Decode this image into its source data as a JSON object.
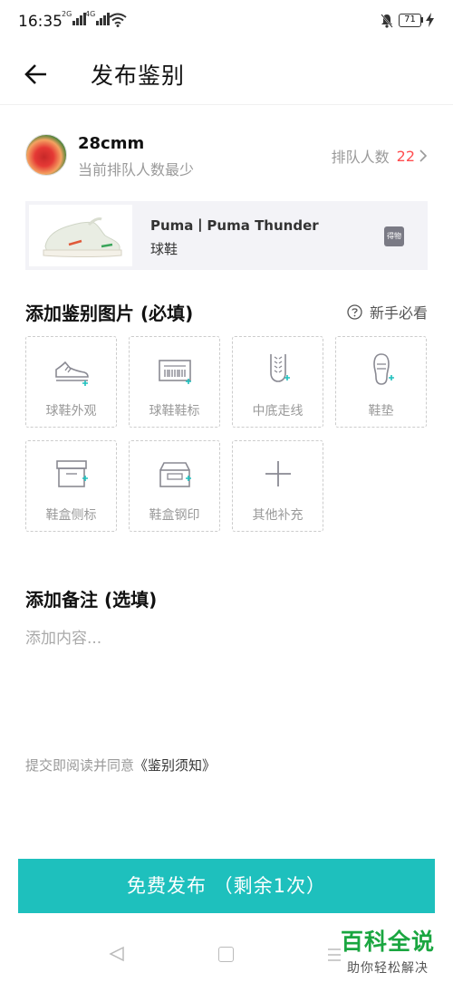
{
  "status_bar": {
    "time": "16:35",
    "signal_1": "2G",
    "signal_2": "4G",
    "battery": "71"
  },
  "nav": {
    "title": "发布鉴别"
  },
  "user": {
    "name": "28cmm",
    "subtitle": "当前排队人数最少",
    "queue_label": "排队人数",
    "queue_count": "22"
  },
  "product": {
    "name": "Puma丨Puma Thunder",
    "category": "球鞋",
    "badge": "得物"
  },
  "images_section": {
    "title": "添加鉴别图片 (必填)",
    "guide_label": "新手必看",
    "tiles": [
      {
        "label": "球鞋外观",
        "icon": "sneaker-icon"
      },
      {
        "label": "球鞋鞋标",
        "icon": "barcode-label-icon"
      },
      {
        "label": "中底走线",
        "icon": "stitching-icon"
      },
      {
        "label": "鞋垫",
        "icon": "insole-icon"
      },
      {
        "label": "鞋盒侧标",
        "icon": "shoebox-side-icon"
      },
      {
        "label": "鞋盒钢印",
        "icon": "shoebox-stamp-icon"
      },
      {
        "label": "其他补充",
        "icon": "plus-icon"
      }
    ]
  },
  "notes_section": {
    "title": "添加备注 (选填)",
    "placeholder": "添加内容..."
  },
  "agreement": {
    "prefix": "提交即阅读并同意",
    "link": "《鉴别须知》"
  },
  "submit": {
    "label": "免费发布 （剩余1次）"
  },
  "watermark": {
    "main": "百科全说",
    "sub": "助你轻松解决"
  },
  "colors": {
    "accent": "#1ec0bd",
    "queue_count": "#ff4d4f",
    "plus_marker": "#1ec0bd"
  }
}
